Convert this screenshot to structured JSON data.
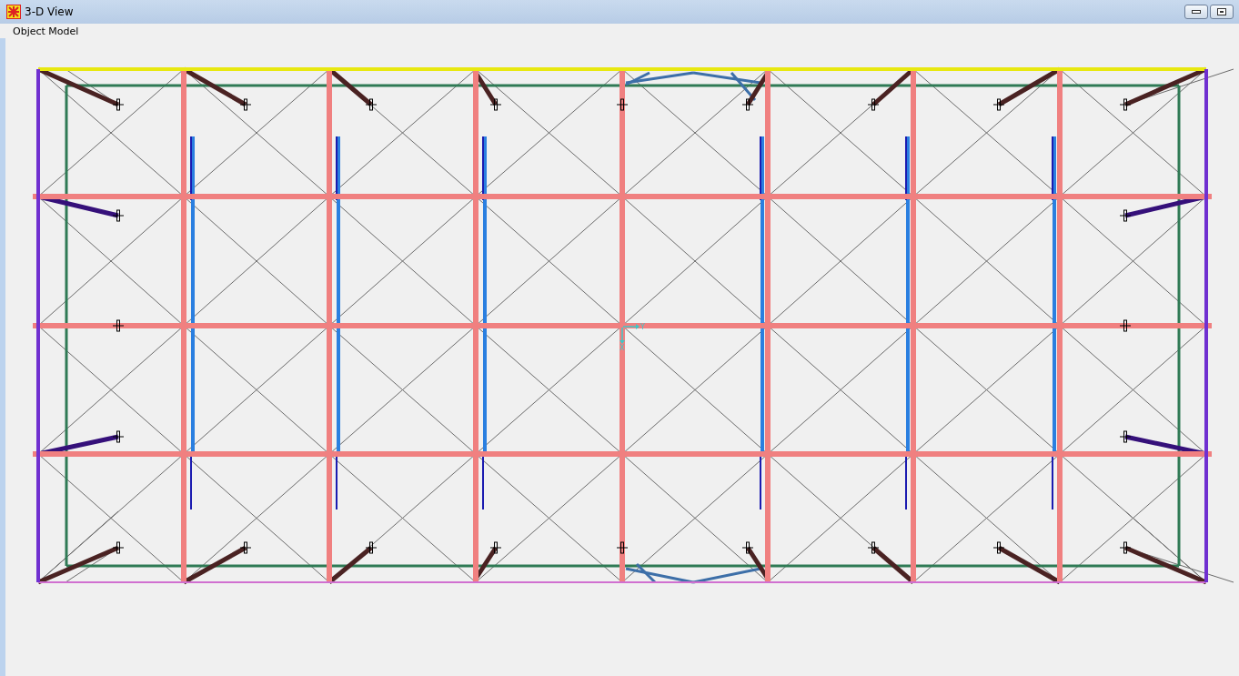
{
  "window": {
    "title": "3-D View"
  },
  "menu": [
    {
      "label": "Object Model"
    }
  ],
  "view": {
    "axis_labels": [
      "Y",
      "X"
    ]
  }
}
